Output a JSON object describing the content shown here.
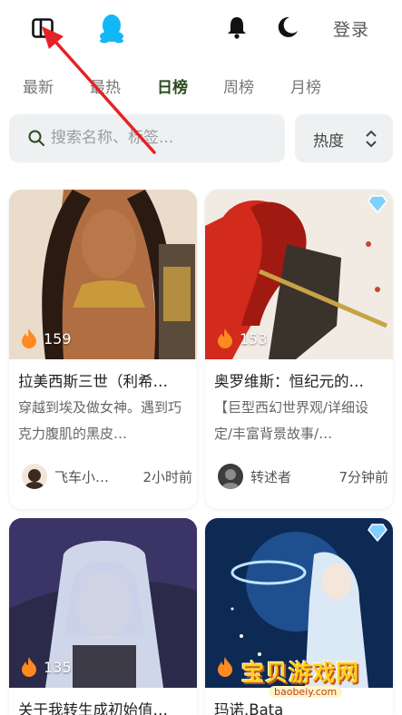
{
  "header": {
    "login_label": "登录",
    "icons": [
      "sidebar-toggle-icon",
      "qq-icon",
      "bell-icon",
      "moon-icon"
    ]
  },
  "tabs": [
    {
      "label": "最新",
      "active": false
    },
    {
      "label": "最热",
      "active": false
    },
    {
      "label": "日榜",
      "active": true
    },
    {
      "label": "周榜",
      "active": false
    },
    {
      "label": "月榜",
      "active": false
    }
  ],
  "search": {
    "placeholder": "搜索名称、标签..."
  },
  "sort": {
    "label": "热度"
  },
  "colors": {
    "accent": "#2c4a22",
    "flame": "#ff8a1f",
    "annotation_arrow": "#e52226",
    "search_bg": "#eef0f1"
  },
  "cards": [
    {
      "heat": "159",
      "title": "拉美西斯三世（利希…",
      "desc": "穿越到埃及做女神。遇到巧克力腹肌的黑皮…",
      "author": "飞车小…",
      "time": "2小时前",
      "badge": false
    },
    {
      "heat": "153",
      "title": "奥罗维斯：恒纪元的…",
      "desc": "【巨型西幻世界观/详细设定/丰富背景故事/…",
      "author": "转述者",
      "time": "7分钟前",
      "badge": true
    },
    {
      "heat": "135",
      "title": "关于我转生成初始值…",
      "badge": false
    },
    {
      "heat": "",
      "title": "玛诺.Bata",
      "badge": true
    }
  ],
  "watermark": {
    "text": "宝贝游戏网",
    "url": "baobeiy.com"
  }
}
